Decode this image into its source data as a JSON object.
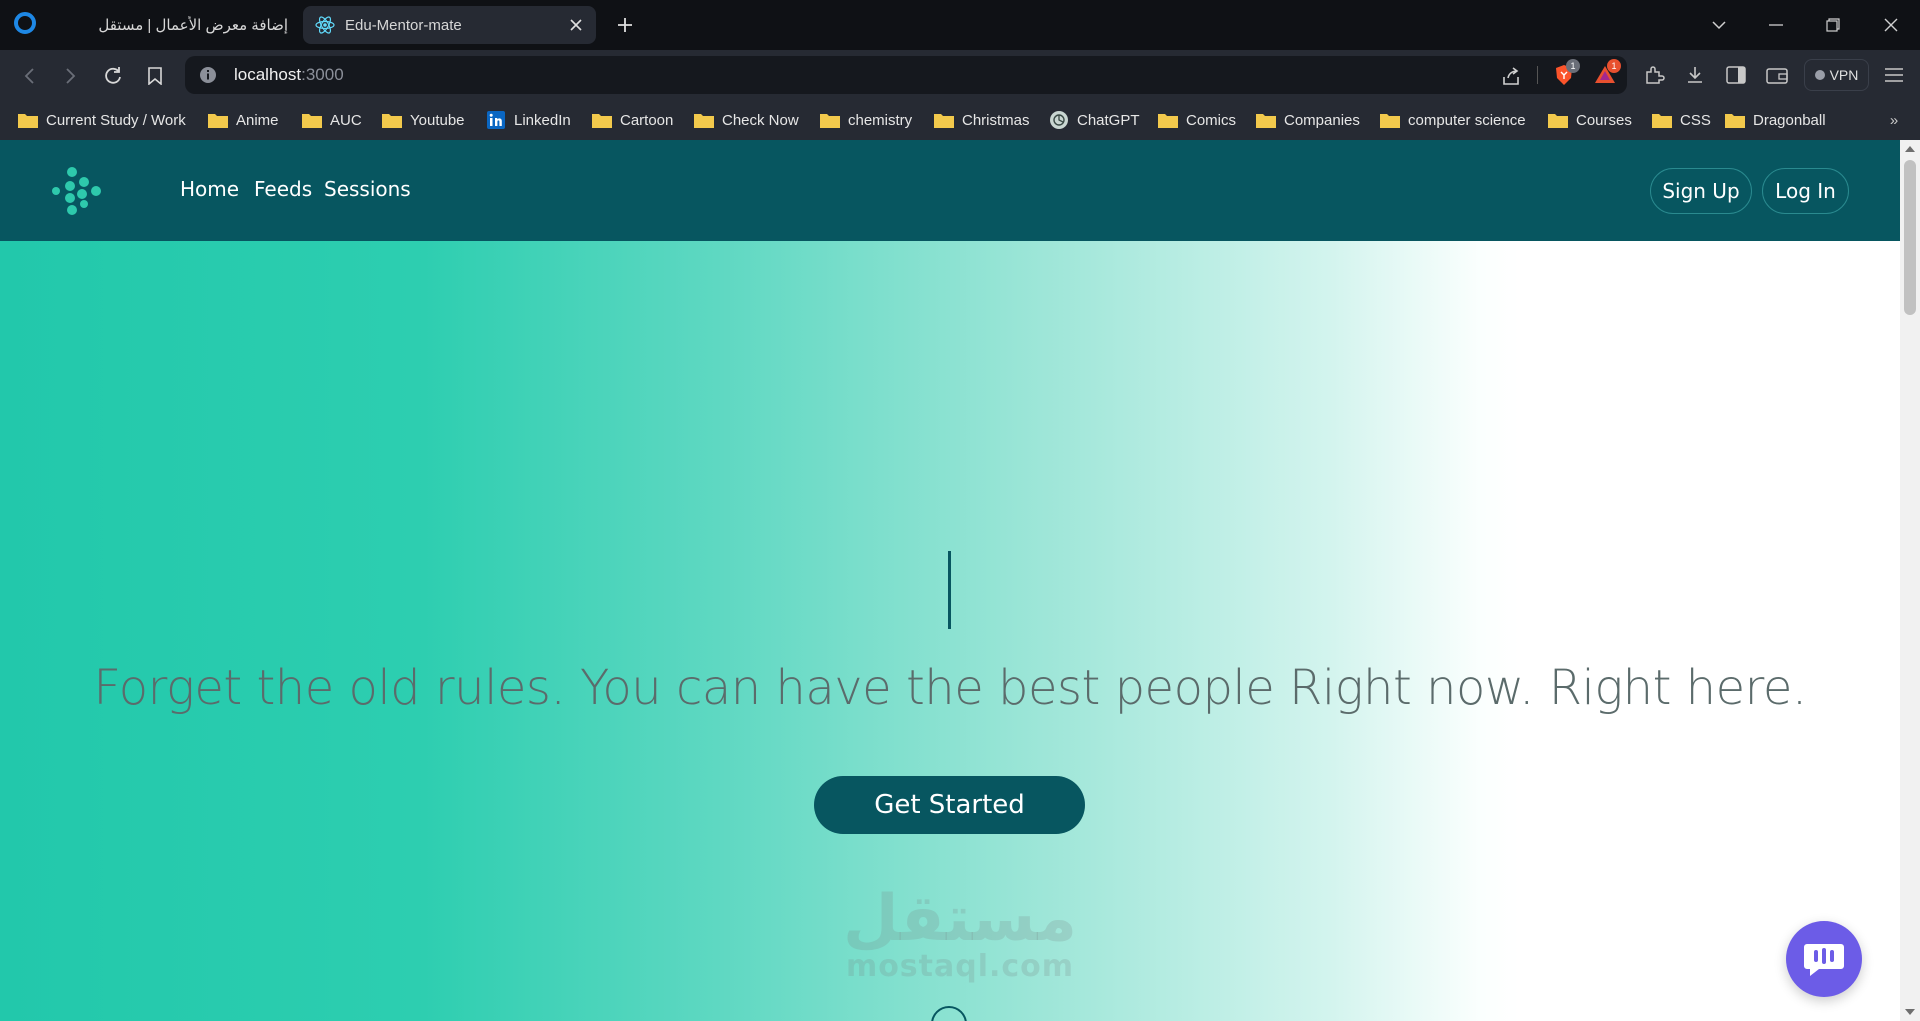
{
  "browser": {
    "tabs": [
      {
        "title": "إضافة معرض الأعمال | مستقل",
        "active": false
      },
      {
        "title": "Edu-Mentor-mate",
        "active": true
      }
    ],
    "url": {
      "host": "localhost",
      "port": ":3000"
    },
    "badges": {
      "brave": "1",
      "rewards": "1"
    },
    "vpn_label": "VPN",
    "bookmarks": [
      {
        "label": "Current Study / Work",
        "icon": "folder-icon"
      },
      {
        "label": "Anime",
        "icon": "folder-icon"
      },
      {
        "label": "AUC",
        "icon": "folder-icon"
      },
      {
        "label": "Youtube",
        "icon": "folder-icon"
      },
      {
        "label": "LinkedIn",
        "icon": "linkedin-icon"
      },
      {
        "label": "Cartoon",
        "icon": "folder-icon"
      },
      {
        "label": "Check Now",
        "icon": "folder-icon"
      },
      {
        "label": "chemistry",
        "icon": "folder-icon"
      },
      {
        "label": "Christmas",
        "icon": "folder-icon"
      },
      {
        "label": "ChatGPT",
        "icon": "chatgpt-icon"
      },
      {
        "label": "Comics",
        "icon": "folder-icon"
      },
      {
        "label": "Companies",
        "icon": "folder-icon"
      },
      {
        "label": "computer science",
        "icon": "folder-icon"
      },
      {
        "label": "Courses",
        "icon": "folder-icon"
      },
      {
        "label": "CSS",
        "icon": "folder-icon"
      },
      {
        "label": "Dragonball",
        "icon": "folder-icon"
      }
    ],
    "more_bookmarks": "»"
  },
  "site": {
    "nav": {
      "home": "Home",
      "feeds": "Feeds",
      "sessions": "Sessions"
    },
    "auth": {
      "signup": "Sign Up",
      "login": "Log In"
    },
    "hero": {
      "tagline": "Forget the old rules. You can have the best people Right now. Right here.",
      "cta": "Get Started"
    },
    "watermark": {
      "arabic": "مستقل",
      "latin": "mostaql.com"
    }
  },
  "colors": {
    "navbar": "#075660",
    "gradient_start": "#22c8ab",
    "cta_bg": "#075660",
    "chat_fab": "#6c5ce7",
    "folder": "#f2c94c"
  }
}
